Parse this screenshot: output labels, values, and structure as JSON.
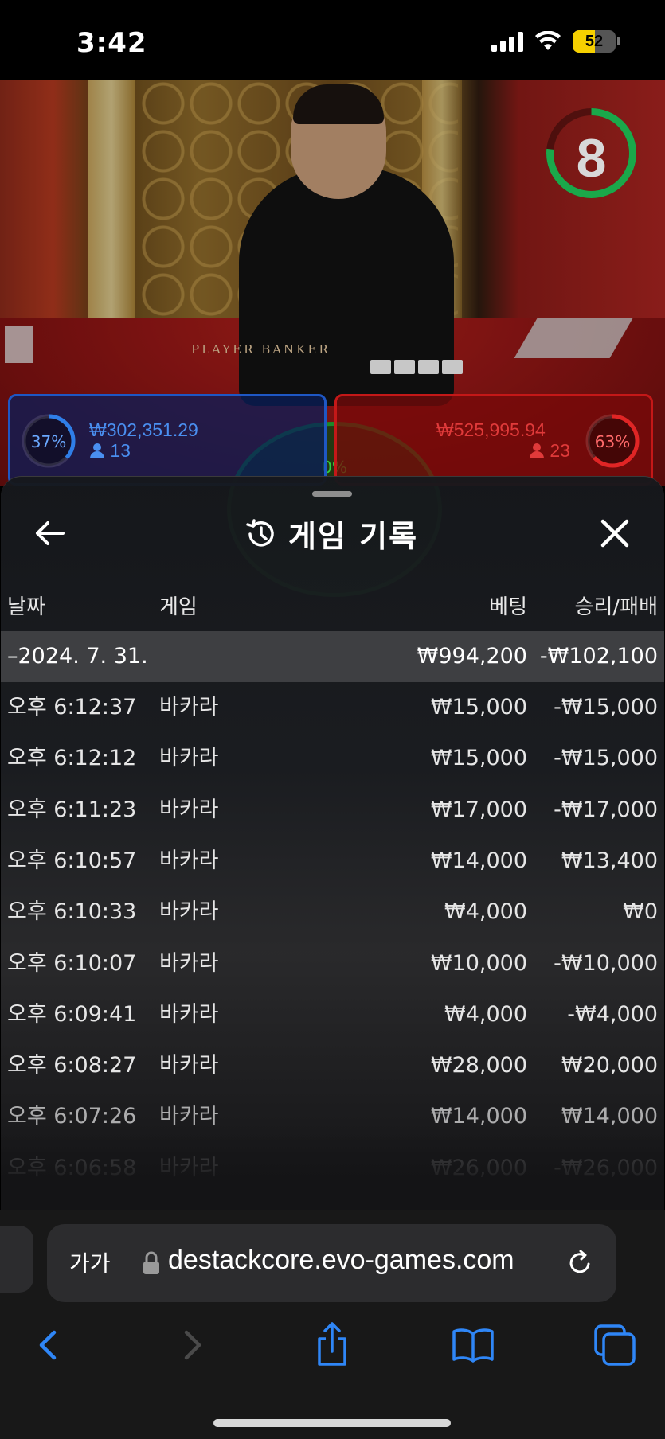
{
  "status_bar": {
    "time": "3:42",
    "battery": "52",
    "battery_level": 0.52,
    "signal_icon": "cellular-signal-icon",
    "wifi_icon": "wifi-icon"
  },
  "game": {
    "timer": "8",
    "table_text": "PLAYER          BANKER",
    "player": {
      "pct": "37%",
      "amount": "₩302,351.29",
      "count": "13"
    },
    "banker": {
      "pct": "63%",
      "amount": "₩525,995.94",
      "count": "23"
    },
    "tie": {
      "pct": "0%"
    }
  },
  "sheet": {
    "title": "게임 기록",
    "title_icon": "history-icon",
    "back_icon": "back-arrow-icon",
    "close_icon": "close-icon",
    "columns": {
      "date": "날짜",
      "game": "게임",
      "bet": "베팅",
      "result": "승리/패배"
    },
    "date_group": {
      "date": "–2024. 7. 31.",
      "bet": "₩994,200",
      "result": "-₩102,100"
    },
    "rows": [
      {
        "time": "오후 6:12:37",
        "game": "바카라",
        "bet": "₩15,000",
        "result": "-₩15,000"
      },
      {
        "time": "오후 6:12:12",
        "game": "바카라",
        "bet": "₩15,000",
        "result": "-₩15,000"
      },
      {
        "time": "오후 6:11:23",
        "game": "바카라",
        "bet": "₩17,000",
        "result": "-₩17,000"
      },
      {
        "time": "오후 6:10:57",
        "game": "바카라",
        "bet": "₩14,000",
        "result": "₩13,400"
      },
      {
        "time": "오후 6:10:33",
        "game": "바카라",
        "bet": "₩4,000",
        "result": "₩0"
      },
      {
        "time": "오후 6:10:07",
        "game": "바카라",
        "bet": "₩10,000",
        "result": "-₩10,000"
      },
      {
        "time": "오후 6:09:41",
        "game": "바카라",
        "bet": "₩4,000",
        "result": "-₩4,000"
      },
      {
        "time": "오후 6:08:27",
        "game": "바카라",
        "bet": "₩28,000",
        "result": "₩20,000"
      },
      {
        "time": "오후 6:07:26",
        "game": "바카라",
        "bet": "₩14,000",
        "result": "₩14,000"
      },
      {
        "time": "오후 6:06:58",
        "game": "바카라",
        "bet": "₩26,000",
        "result": "-₩26,000"
      }
    ]
  },
  "browser": {
    "text_size_label": "가가",
    "url": "destackcore.evo-games.com",
    "lock_icon": "lock-icon",
    "reload_icon": "reload-icon",
    "toolbar": [
      "back-icon",
      "forward-icon",
      "share-icon",
      "bookmarks-icon",
      "tabs-icon"
    ]
  }
}
